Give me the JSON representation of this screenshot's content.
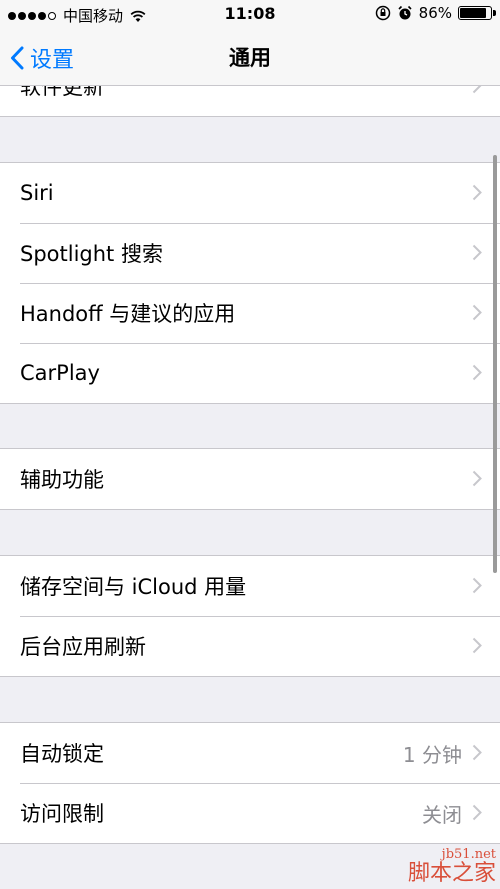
{
  "status": {
    "carrier": "中国移动",
    "time": "11:08",
    "battery": "86%",
    "battery_level": 0.86
  },
  "nav": {
    "back_label": "设置",
    "title": "通用"
  },
  "partial_row": {
    "label": "软件更新"
  },
  "group1": [
    {
      "label": "Siri"
    },
    {
      "label": "Spotlight 搜索"
    },
    {
      "label": "Handoff 与建议的应用"
    },
    {
      "label": "CarPlay"
    }
  ],
  "group2": [
    {
      "label": "辅助功能"
    }
  ],
  "group3": [
    {
      "label": "储存空间与 iCloud 用量"
    },
    {
      "label": "后台应用刷新"
    }
  ],
  "group4": [
    {
      "label": "自动锁定",
      "value": "1 分钟"
    },
    {
      "label": "访问限制",
      "value": "关闭"
    }
  ],
  "watermark": {
    "line1": "jb51.net",
    "line2": "脚本之家"
  },
  "colors": {
    "accent": "#007aff",
    "background": "#efeff4",
    "separator": "#c8c7cc",
    "secondary_text": "#8e8e93"
  }
}
